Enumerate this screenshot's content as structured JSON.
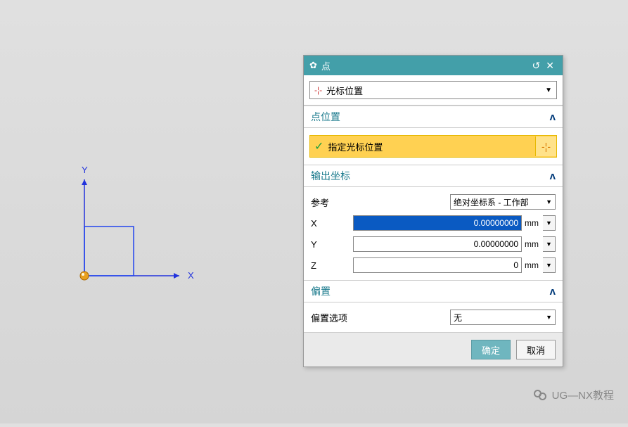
{
  "dialog": {
    "title": "点",
    "type_label": "光标位置"
  },
  "sections": {
    "point_loc": {
      "title": "点位置",
      "specify": "指定光标位置"
    },
    "output": {
      "title": "输出坐标",
      "ref_label": "参考",
      "ref_value": "绝对坐标系 - 工作部",
      "x_label": "X",
      "x_value": "0.00000000",
      "x_unit": "mm",
      "y_label": "Y",
      "y_value": "0.00000000",
      "y_unit": "mm",
      "z_label": "Z",
      "z_value": "0",
      "z_unit": "mm"
    },
    "offset": {
      "title": "偏置",
      "option_label": "偏置选项",
      "option_value": "无"
    }
  },
  "buttons": {
    "ok": "确定",
    "cancel": "取消"
  },
  "axes": {
    "x": "X",
    "y": "Y"
  },
  "watermark": "UG—NX教程"
}
